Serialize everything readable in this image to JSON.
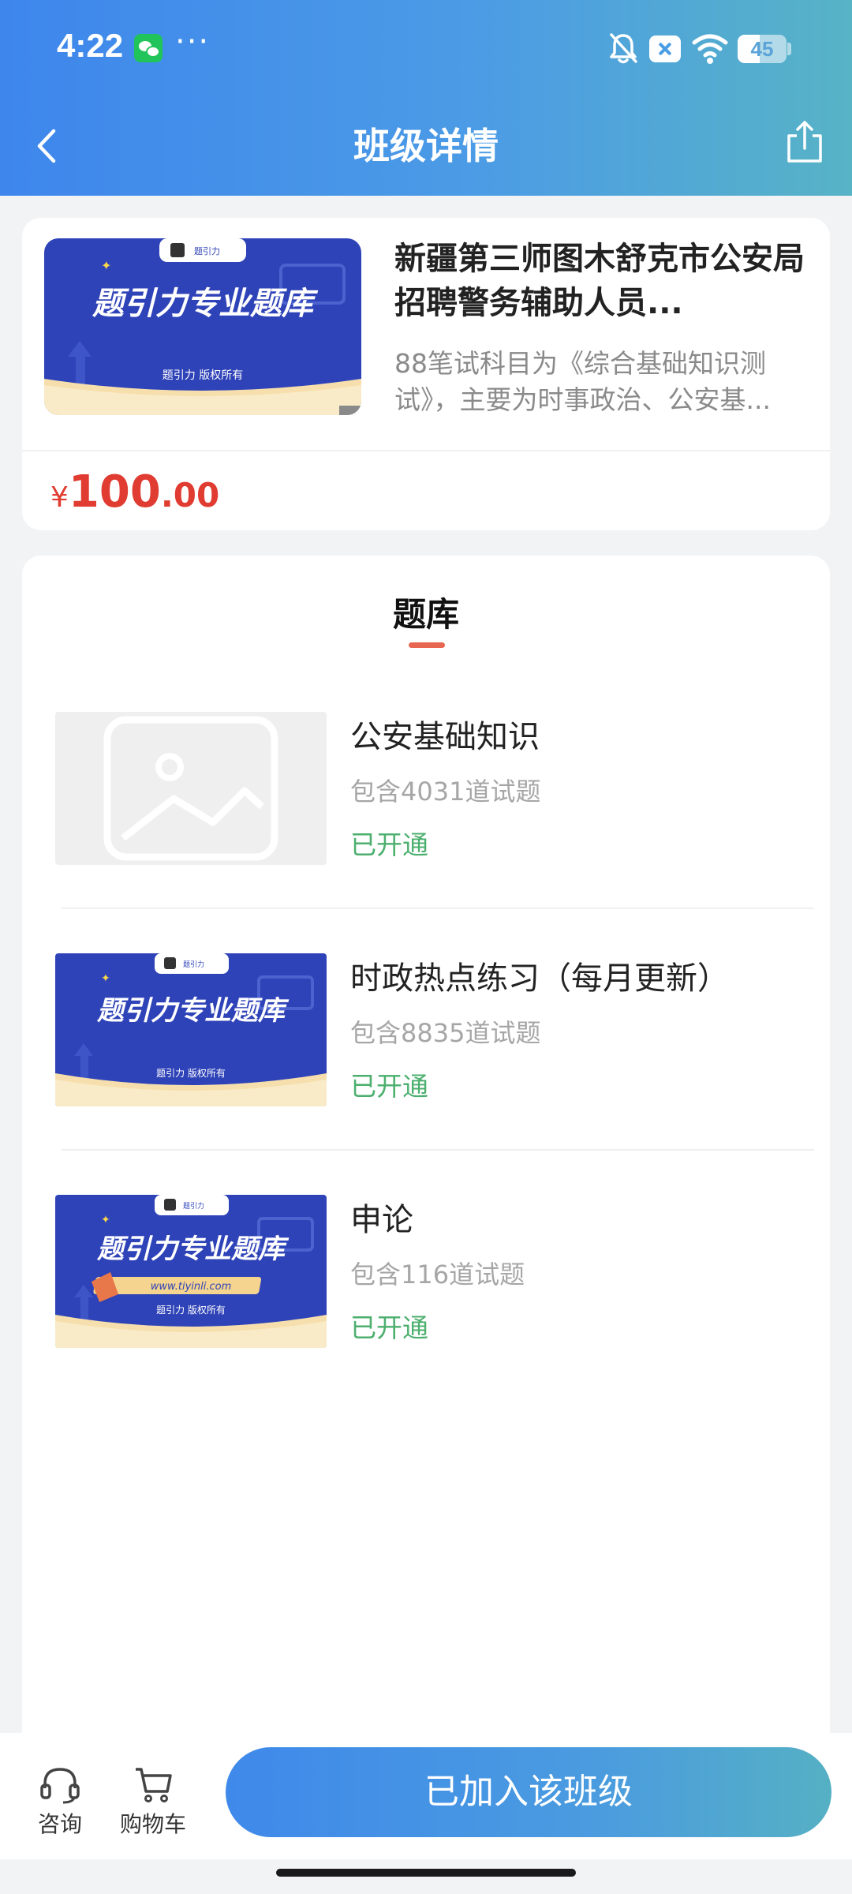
{
  "status_bar": {
    "time": "4:22",
    "more": "···",
    "battery": "45",
    "battery_level": 0.45
  },
  "header": {
    "title": "班级详情"
  },
  "course": {
    "title": "新疆第三师图木舒克市公安局招聘警务辅助人员...",
    "description": "88笔试科目为《综合基础知识测试》，主要为时事政治、公安基...",
    "price_symbol": "¥",
    "price_int": "100",
    "price_dec": ".00",
    "banner": {
      "logo_text": "题引力",
      "headline": "题引力专业题库",
      "footer": "题引力 版权所有"
    }
  },
  "question_bank": {
    "heading": "题库",
    "items": [
      {
        "name": "公安基础知识",
        "count": "包含4031道试题",
        "status": "已开通",
        "thumb": "placeholder"
      },
      {
        "name": "时政热点练习（每月更新）",
        "count": "包含8835道试题",
        "status": "已开通",
        "thumb": "banner",
        "banner": {
          "logo_text": "题引力",
          "headline": "题引力专业题库",
          "footer": "题引力 版权所有"
        }
      },
      {
        "name": "申论",
        "count": "包含116道试题",
        "status": "已开通",
        "thumb": "banner-url",
        "banner": {
          "logo_text": "题引力",
          "headline": "题引力专业题库",
          "url": "www.tiyinli.com",
          "footer": "题引力 版权所有"
        }
      }
    ]
  },
  "bottom_bar": {
    "consult_label": "咨询",
    "cart_label": "购物车",
    "join_label": "已加入该班级"
  },
  "colors": {
    "header_gradient_start": "#3e86ec",
    "header_gradient_end": "#57b3c6",
    "price": "#e03c31",
    "status_open": "#4caf6e",
    "tab_underline": "#e76650",
    "banner_blue": "#2f43b8"
  },
  "icons": {
    "back": "chevron-left-icon",
    "share": "share-icon",
    "consult": "headset-icon",
    "cart": "cart-icon",
    "placeholder": "image-placeholder-icon"
  }
}
